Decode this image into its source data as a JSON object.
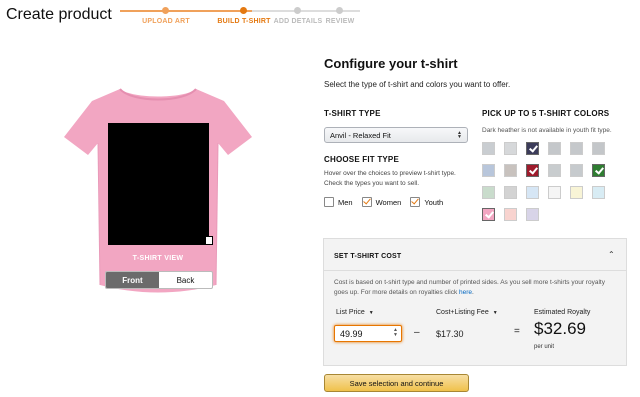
{
  "page": {
    "title": "Create product"
  },
  "stepper": {
    "steps": [
      {
        "label": "UPLOAD ART",
        "color": "#f0a15b"
      },
      {
        "label": "BUILD T-SHIRT",
        "color": "#e47911"
      },
      {
        "label": "ADD DETAILS",
        "color": "#bbbbbb"
      },
      {
        "label": "REVIEW",
        "color": "#bbbbbb"
      }
    ],
    "active_index": 1
  },
  "preview": {
    "shirt_color": "#f2a6c2",
    "view_label": "T-SHIRT VIEW",
    "front_label": "Front",
    "back_label": "Back",
    "active_view": "Front"
  },
  "config": {
    "heading": "Configure your t-shirt",
    "subheading": "Select the type of t-shirt and colors you want to offer.",
    "type_label": "T-SHIRT TYPE",
    "type_value": "Anvil - Relaxed Fit",
    "fit_label": "CHOOSE FIT TYPE",
    "fit_desc": "Hover over the choices to preview t-shirt type. Check the types you want to sell.",
    "fits": [
      {
        "label": "Men",
        "checked": false
      },
      {
        "label": "Women",
        "checked": true
      },
      {
        "label": "Youth",
        "checked": true
      }
    ]
  },
  "colors": {
    "label": "PICK UP TO 5 T-SHIRT COLORS",
    "note": "Dark heather is not available in youth fit type.",
    "swatches": [
      {
        "color": "#c9cdd1",
        "selected": false
      },
      {
        "color": "#d6d8da",
        "selected": false
      },
      {
        "color": "#3c3c5a",
        "selected": true
      },
      {
        "color": "#c4c7ca",
        "selected": false
      },
      {
        "color": "#c5c8cb",
        "selected": false
      },
      {
        "color": "#c3c6c9",
        "selected": false
      },
      {
        "color": "#b8c6db",
        "selected": false
      },
      {
        "color": "#c8c2be",
        "selected": false
      },
      {
        "color": "#9e1b2c",
        "selected": true
      },
      {
        "color": "#c8ccce",
        "selected": false
      },
      {
        "color": "#c6cacd",
        "selected": false
      },
      {
        "color": "#2f7d32",
        "selected": true
      },
      {
        "color": "#c9dccc",
        "selected": false
      },
      {
        "color": "#d3d3d3",
        "selected": false
      },
      {
        "color": "#d6e6f5",
        "selected": false
      },
      {
        "color": "#f5f5f5",
        "selected": false
      },
      {
        "color": "#f8f4d6",
        "selected": false
      },
      {
        "color": "#d8ecf4",
        "selected": false
      },
      {
        "color": "#f2a6c2",
        "selected": true
      },
      {
        "color": "#f8d3cf",
        "selected": false
      },
      {
        "color": "#d8d4e8",
        "selected": false
      }
    ]
  },
  "cost": {
    "header": "SET T-SHIRT COST",
    "desc_text": "Cost is based on t-shirt type and number of printed sides. As you sell more t-shirts your royalty goes up. For more details on royalties click ",
    "desc_link": "here",
    "desc_end": ".",
    "list_price_label": "List Price",
    "list_price_value": "49.99",
    "listing_fee_label": "Cost+Listing Fee",
    "listing_fee_value": "$17.30",
    "royalty_label": "Estimated Royalty",
    "royalty_value": "$32.69",
    "per_unit": "per unit",
    "minus": "–",
    "equals": "="
  },
  "actions": {
    "continue_label": "Save selection and continue"
  }
}
